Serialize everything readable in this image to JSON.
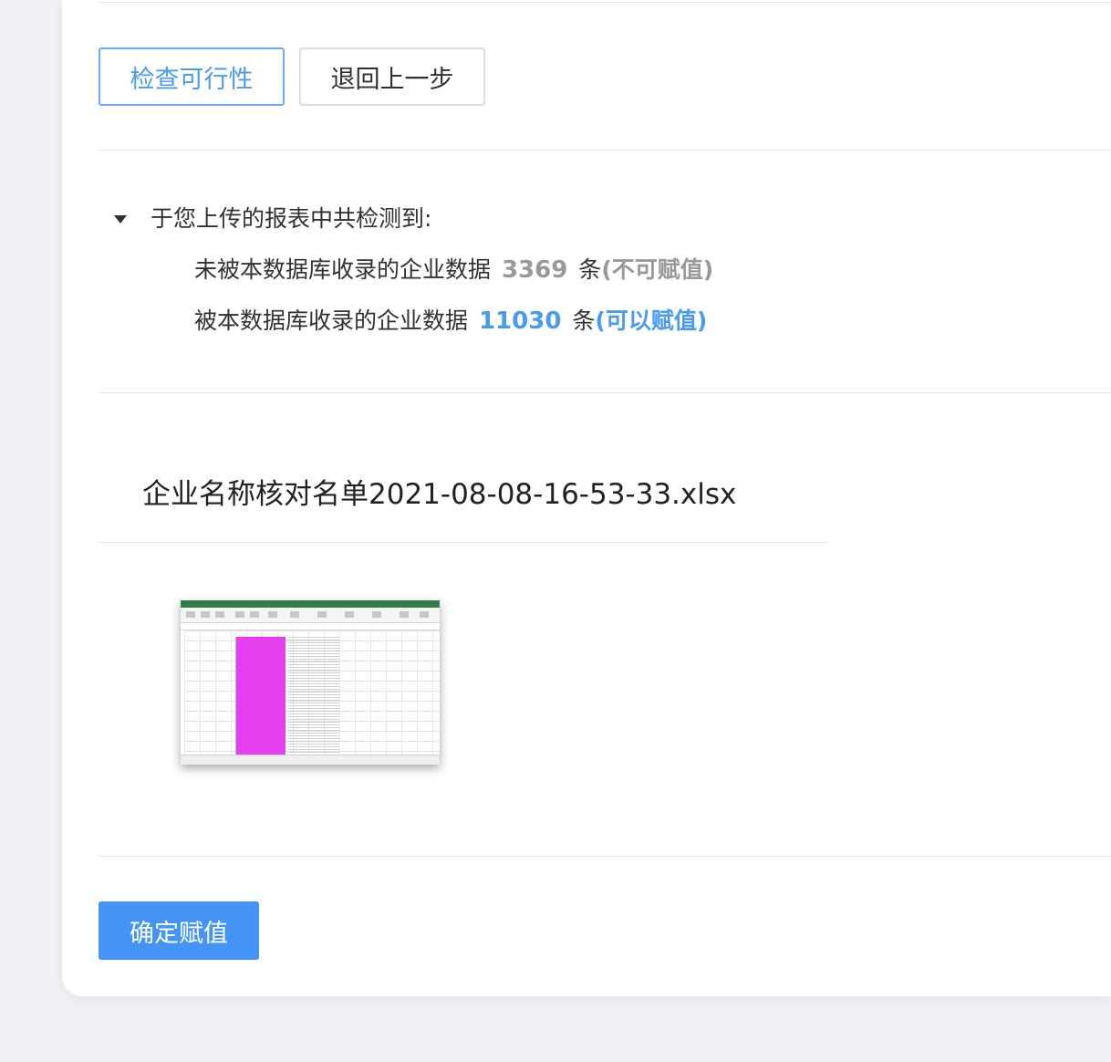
{
  "actions": {
    "check_label": "检查可行性",
    "back_label": "退回上一步",
    "confirm_label": "确定赋值"
  },
  "summary": {
    "title": "于您上传的报表中共检测到:",
    "not_included": {
      "prefix": "未被本数据库收录的企业数据",
      "count": "3369",
      "unit": "条",
      "note": "(不可赋值)"
    },
    "included": {
      "prefix": "被本数据库收录的企业数据",
      "count": "11030",
      "unit": "条",
      "note": "(可以赋值)"
    }
  },
  "file": {
    "name": "企业名称核对名单2021-08-08-16-53-33.xlsx"
  },
  "colors": {
    "primary": "#4394f4",
    "muted": "#999999",
    "highlight": "#e63ff0"
  }
}
